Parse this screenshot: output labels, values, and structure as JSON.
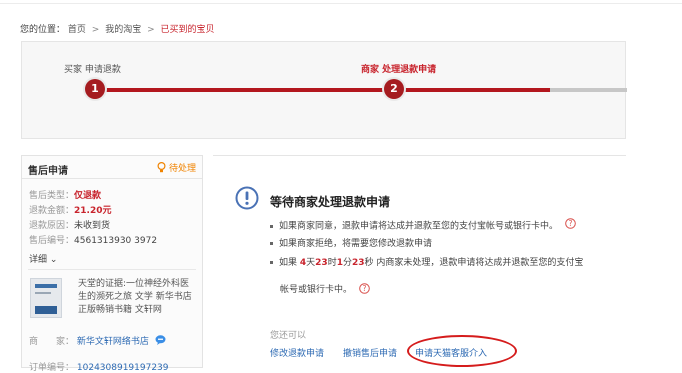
{
  "breadcrumb": {
    "prefix": "您的位置：",
    "items": [
      "首页",
      "我的淘宝",
      "已买到的宝贝"
    ],
    "separator": ">"
  },
  "progress": {
    "steps": [
      {
        "number": "1",
        "label": "买家 申请退款",
        "state": "done"
      },
      {
        "number": "2",
        "label": "商家 处理退款申请",
        "state": "current"
      }
    ]
  },
  "sidebar": {
    "title": "售后申请",
    "status": "待处理",
    "fields": [
      {
        "key": "售后类型：",
        "value": "仅退款"
      },
      {
        "key": "退款金额：",
        "value": "21.20元"
      },
      {
        "key": "退款原因：",
        "value": "未收到货"
      },
      {
        "key": "售后编号：",
        "value": "4561313930 3972"
      }
    ],
    "detail_label": "详细",
    "detail_arrow": "⌄",
    "product_title": "天堂的证据:一位神经外科医生的濒死之旅 文学 新华书店正版畅销书籍 文轩网",
    "seller_key": "商　　家：",
    "seller_name": "新华文轩网络书店",
    "order_key": "订单编号：",
    "order_number": "1024308919197239"
  },
  "main": {
    "heading": "等待商家处理退款申请",
    "bullets": [
      "如果商家同意，退款申请将达成并退款至您的支付宝帐号或银行卡中。",
      "如果商家拒绝，将需要您修改退款申请"
    ],
    "bullet3_prefix": "如果",
    "countdown": {
      "days": "4",
      "hours": "23",
      "minutes": "1",
      "seconds": "23"
    },
    "countdown_units": {
      "day": "天",
      "hour": "时",
      "minute": "分",
      "second": "秒"
    },
    "bullet3_suffix": "内商家未处理，退款申请将达成并退款至您的支付宝",
    "bullet3_cont": "帐号或银行卡中。",
    "can_do_label": "您还可以",
    "actions": [
      "修改退款申请",
      "撤销售后申请",
      "申请天猫客服介入"
    ]
  },
  "colors": {
    "accent_red": "#b3171e",
    "link_blue": "#2d6ab3",
    "status_orange": "#f08300"
  }
}
